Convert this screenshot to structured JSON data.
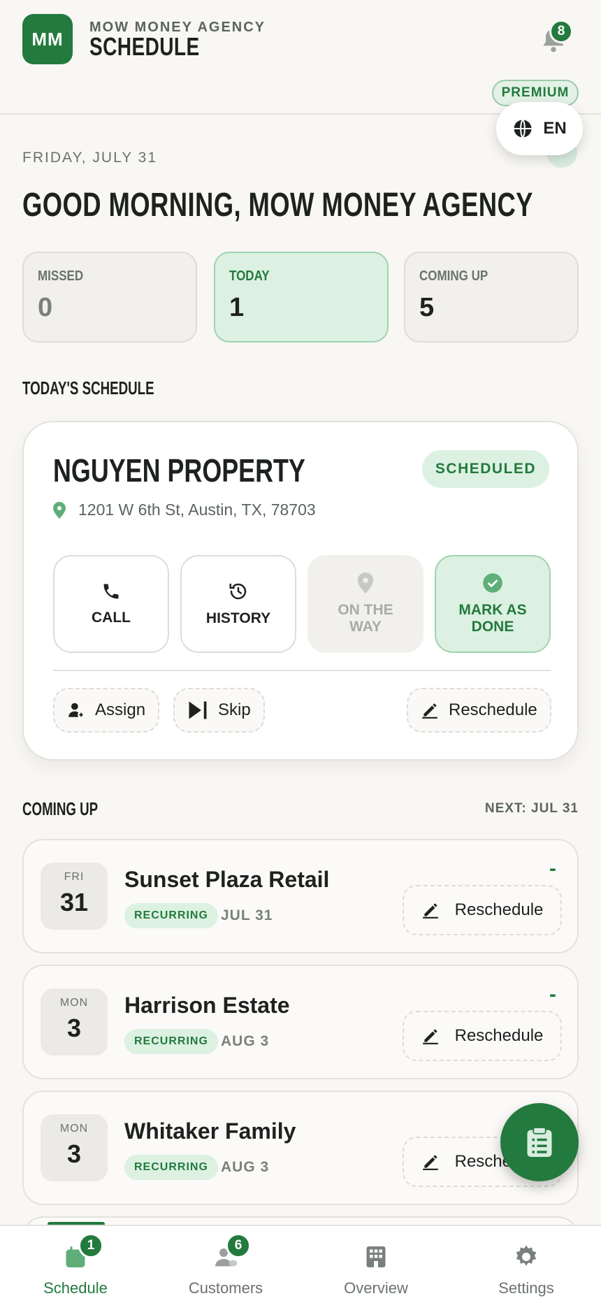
{
  "header": {
    "logo_initials": "MM",
    "agency_name": "MOW MONEY AGENCY",
    "title": "SCHEDULE",
    "notification_count": "8",
    "premium_label": "PREMIUM",
    "language": "EN"
  },
  "greeting": {
    "date": "FRIDAY, JULY 31",
    "text": "GOOD MORNING, MOW MONEY AGENCY"
  },
  "stats": [
    {
      "label": "MISSED",
      "value": "0"
    },
    {
      "label": "TODAY",
      "value": "1"
    },
    {
      "label": "COMING UP",
      "value": "5"
    }
  ],
  "todays_schedule": {
    "section_title": "TODAY'S SCHEDULE",
    "property_name": "NGUYEN PROPERTY",
    "status": "SCHEDULED",
    "address": "1201 W 6th St, Austin, TX, 78703",
    "actions": [
      {
        "label": "CALL",
        "icon": "phone-icon"
      },
      {
        "label": "HISTORY",
        "icon": "history-icon"
      },
      {
        "label_line1": "ON THE",
        "label_line2": "WAY",
        "icon": "location-pin-icon"
      },
      {
        "label_line1": "MARK AS",
        "label_line2": "DONE",
        "icon": "check-circle-icon"
      }
    ],
    "chips": [
      {
        "label": "Assign",
        "icon": "assign-user-icon"
      },
      {
        "label": "Skip",
        "icon": "skip-icon"
      },
      {
        "label": "Reschedule",
        "icon": "pencil-icon"
      }
    ]
  },
  "coming_up": {
    "section_title": "COMING UP",
    "next_label": "NEXT: JUL 31",
    "items": [
      {
        "dow": "FRI",
        "day": "31",
        "name": "Sunset Plaza Retail",
        "tag": "RECURRING",
        "date": "JUL 31",
        "marker": "-",
        "action": "Reschedule"
      },
      {
        "dow": "MON",
        "day": "3",
        "name": "Harrison Estate",
        "tag": "RECURRING",
        "date": "AUG 3",
        "marker": "-",
        "action": "Reschedule"
      },
      {
        "dow": "MON",
        "day": "3",
        "name": "Whitaker Family",
        "tag": "RECURRING",
        "date": "AUG 3",
        "marker": "-",
        "action": "Reschedule"
      }
    ]
  },
  "bottom_nav": [
    {
      "label": "Schedule",
      "badge": "1",
      "icon": "calendar-icon",
      "active": true
    },
    {
      "label": "Customers",
      "badge": "6",
      "icon": "customers-icon",
      "active": false
    },
    {
      "label": "Overview",
      "badge": "",
      "icon": "building-icon",
      "active": false
    },
    {
      "label": "Settings",
      "badge": "",
      "icon": "gear-icon",
      "active": false
    }
  ],
  "colors": {
    "accent": "#237a3e",
    "accent_light": "#dcf1e2",
    "background": "#f8f7f4"
  }
}
